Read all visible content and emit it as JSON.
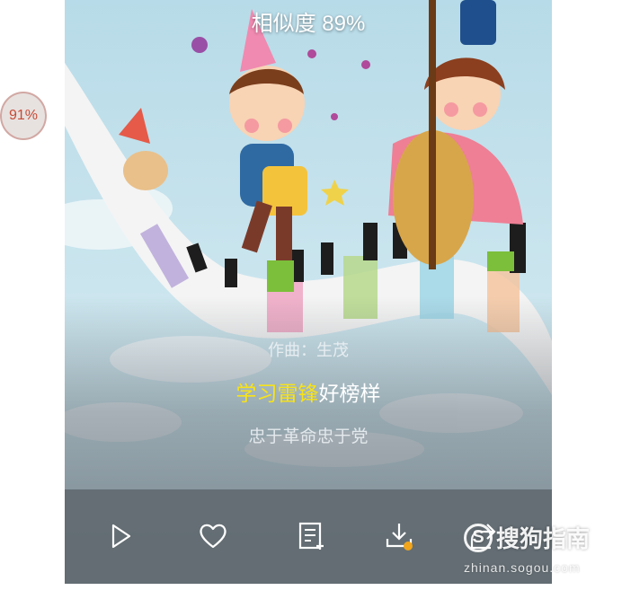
{
  "header": {
    "similarity": "相似度 89%"
  },
  "lyrics": {
    "composer": "作曲：生茂",
    "current_highlight": "学习雷锋",
    "current_rest": "好榜样",
    "next": "忠于革命忠于党"
  },
  "side_badge": {
    "text": "91%"
  },
  "toolbar": {
    "play": "play-icon",
    "like": "heart-icon",
    "playlist": "playlist-add-icon",
    "download": "download-icon",
    "share": "share-icon"
  },
  "watermark": {
    "logo_text": "搜狗指南",
    "logo_mark": "S",
    "url": "zhinan.sogou.com"
  },
  "colors": {
    "highlight": "#f7e21a",
    "badge_text": "#c84a36"
  }
}
